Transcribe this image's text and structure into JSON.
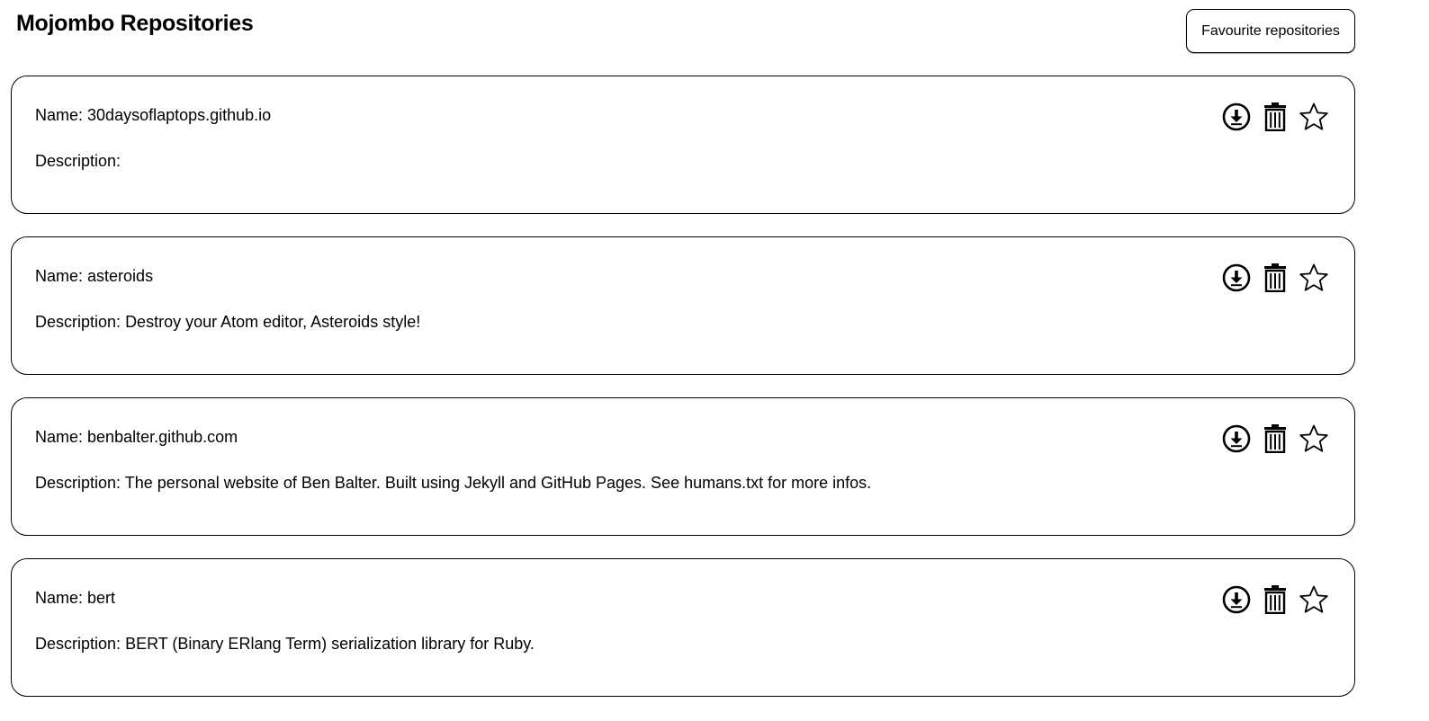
{
  "header": {
    "title": "Mojombo Repositories",
    "favourites_label": "Favourite repositories"
  },
  "labels": {
    "name_prefix": "Name:",
    "description_prefix": "Description:"
  },
  "icons": {
    "download": "download-circle-icon",
    "delete": "trash-icon",
    "favourite": "star-outline-icon"
  },
  "repositories": [
    {
      "name": "30daysoflaptops.github.io",
      "description": ""
    },
    {
      "name": "asteroids",
      "description": "Destroy your Atom editor, Asteroids style!"
    },
    {
      "name": "benbalter.github.com",
      "description": "The personal website of Ben Balter. Built using Jekyll and GitHub Pages. See humans.txt for more infos."
    },
    {
      "name": "bert",
      "description": "BERT (Binary ERlang Term) serialization library for Ruby."
    }
  ]
}
